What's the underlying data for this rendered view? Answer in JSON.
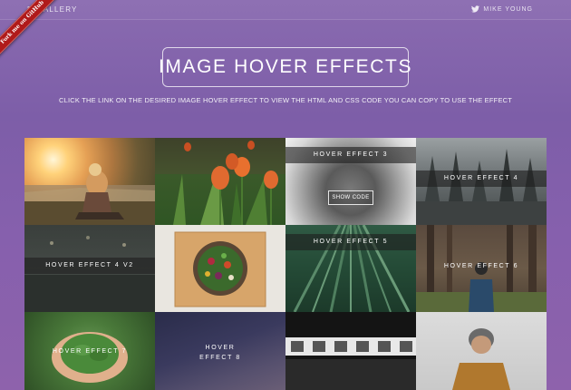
{
  "topbar": {
    "brand": "R GALLERY",
    "author": "MIKE YOUNG",
    "author_icon": "twitter-icon"
  },
  "ribbon": {
    "text": "Fork me on GitHub"
  },
  "header": {
    "title": "IMAGE HOVER EFFECTS",
    "subtitle": "CLICK THE LINK ON THE DESIRED IMAGE HOVER EFFECT TO VIEW THE HTML AND CSS CODE YOU CAN COPY TO USE THE EFFECT"
  },
  "tiles": [
    {
      "caption": ""
    },
    {
      "caption": ""
    },
    {
      "caption": "HOVER EFFECT 3",
      "button": "SHOW CODE"
    },
    {
      "caption": "HOVER EFFECT 4"
    },
    {
      "caption": "HOVER EFFECT 4 V2"
    },
    {
      "caption": ""
    },
    {
      "caption": "HOVER EFFECT 5"
    },
    {
      "caption": "HOVER EFFECT 6"
    },
    {
      "caption": "HOVER EFFECT 7"
    },
    {
      "caption_line1": "HOVER",
      "caption_line2": "EFFECT 8"
    },
    {
      "caption": ""
    },
    {
      "caption": ""
    }
  ],
  "colors": {
    "background": "#8a6bb0",
    "ribbon": "#b01a1a"
  }
}
